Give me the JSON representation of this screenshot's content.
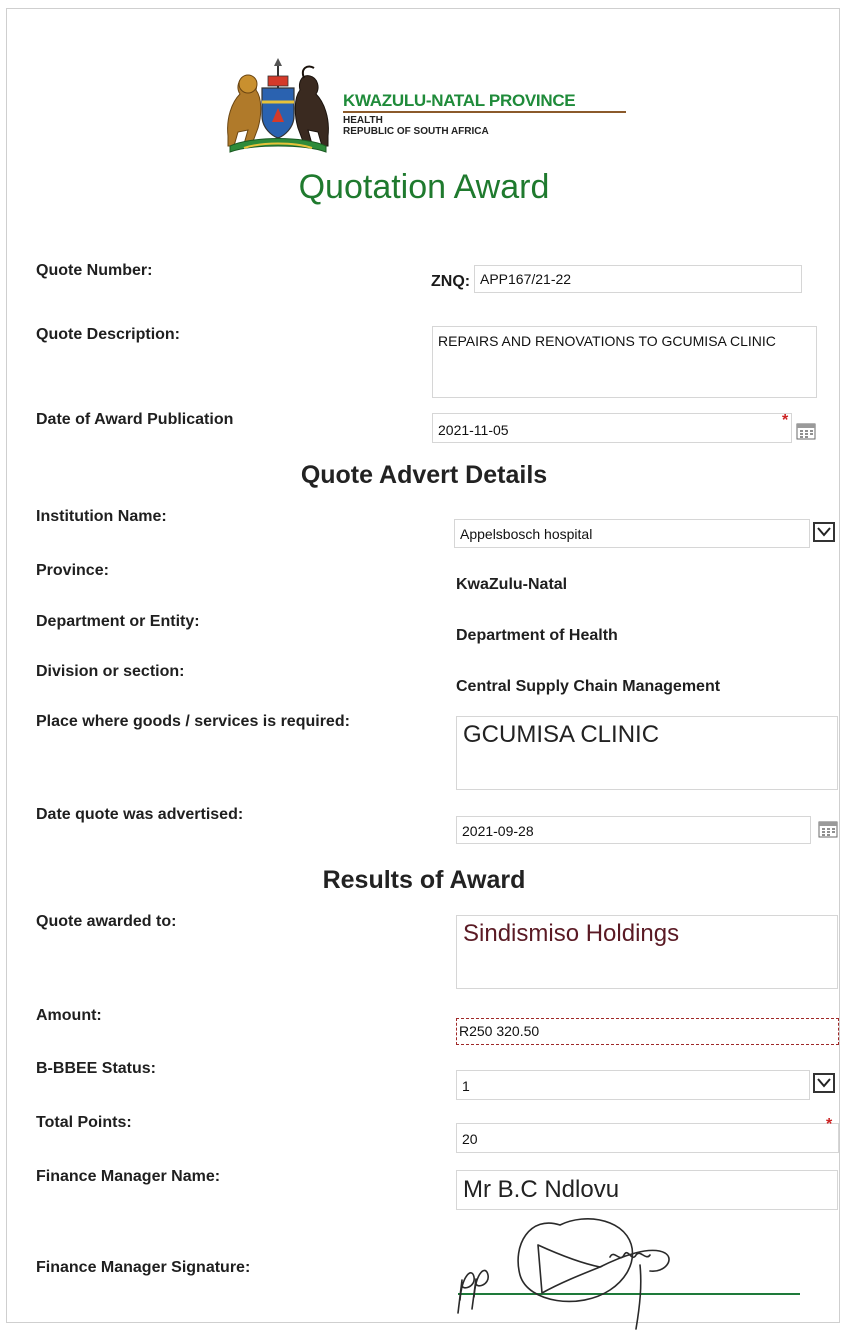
{
  "header": {
    "province_name": "KWAZULU-NATAL PROVINCE",
    "department": "HEALTH",
    "country": "REPUBLIC OF SOUTH AFRICA",
    "title": "Quotation Award"
  },
  "quote": {
    "number_label": "Quote Number:",
    "number_prefix": "ZNQ:",
    "number_value": "APP167/21-22",
    "description_label": "Quote Description:",
    "description_value": "REPAIRS AND RENOVATIONS TO GCUMISA CLINIC",
    "award_date_label": "Date of Award Publication",
    "award_date_value": "2021-11-05"
  },
  "advert": {
    "section_title": "Quote Advert Details",
    "institution_label": "Institution Name:",
    "institution_value": "Appelsbosch hospital",
    "province_label": "Province:",
    "province_value": "KwaZulu-Natal",
    "department_label": "Department or Entity:",
    "department_value": "Department of Health",
    "division_label": "Division or section:",
    "division_value": "Central Supply Chain Management",
    "place_label": "Place where goods /  services is required:",
    "place_value": "GCUMISA CLINIC",
    "advertised_label": "Date quote was advertised:",
    "advertised_value": "2021-09-28"
  },
  "results": {
    "section_title": "Results of Award",
    "awarded_label": "Quote awarded to:",
    "awarded_value": "Sindismiso Holdings",
    "amount_label": "Amount:",
    "amount_value": "R250 320.50",
    "bbbee_label": "B-BBEE Status:",
    "bbbee_value": "1",
    "points_label": "Total Points:",
    "points_value": "20",
    "manager_label": "Finance Manager Name:",
    "manager_value": "Mr B.C Ndlovu",
    "signature_label": "Finance Manager Signature:"
  },
  "icons": {
    "dropdown": "chevron-down-icon",
    "calendar": "calendar-icon",
    "required": "*"
  },
  "colors": {
    "brand_green": "#1f8b3a",
    "title_green": "#1f7a2e",
    "required_red": "#cc2222"
  }
}
